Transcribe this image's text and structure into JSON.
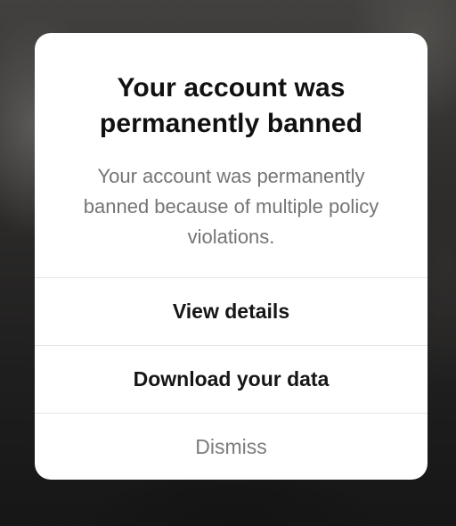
{
  "modal": {
    "title": "Your account was permanently banned",
    "message": "Your account was permanently banned because of multiple policy violations.",
    "actions": [
      {
        "label": "View details",
        "style": "primary"
      },
      {
        "label": "Download your data",
        "style": "primary"
      },
      {
        "label": "Dismiss",
        "style": "muted"
      }
    ]
  },
  "colors": {
    "title": "#111111",
    "message": "#747474",
    "dismiss": "#7b7b7b",
    "divider": "#e6e6e6",
    "dialog_bg": "#ffffff"
  }
}
